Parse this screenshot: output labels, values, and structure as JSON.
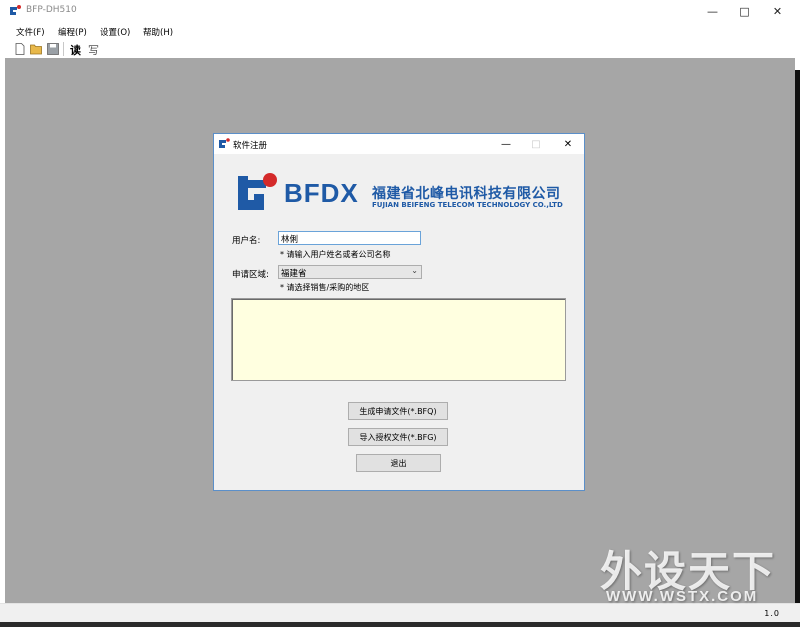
{
  "window": {
    "title": "BFP-DH510",
    "menu": [
      "文件(F)",
      "编程(P)",
      "设置(O)",
      "帮助(H)"
    ],
    "toolbar": {
      "read_label": "读",
      "write_label": "写"
    }
  },
  "dialog": {
    "title": "软件注册",
    "brand": "BFDX",
    "company_cn": "福建省北峰电讯科技有限公司",
    "company_en": "FUJIAN BEIFENG TELECOM TECHNOLOGY CO.,LTD",
    "username": {
      "label": "用户名:",
      "value": "林俐",
      "hint": "* 请输入用户姓名或者公司名称"
    },
    "region": {
      "label": "申请区域:",
      "value": "福建省",
      "hint": "* 请选择销售/采购的地区"
    },
    "buttons": {
      "generate": "生成申请文件(*.BFQ)",
      "import": "导入授权文件(*.BFG)",
      "exit": "退出"
    }
  },
  "status": {
    "version": "1.0"
  },
  "watermark": {
    "cn": "外设天下",
    "en": "WWW.WSTX.COM"
  },
  "colors": {
    "brand_blue": "#1f5aa6",
    "brand_red": "#d42a2a",
    "mdi_gray": "#a6a6a6",
    "textarea_bg": "#ffffe0"
  }
}
